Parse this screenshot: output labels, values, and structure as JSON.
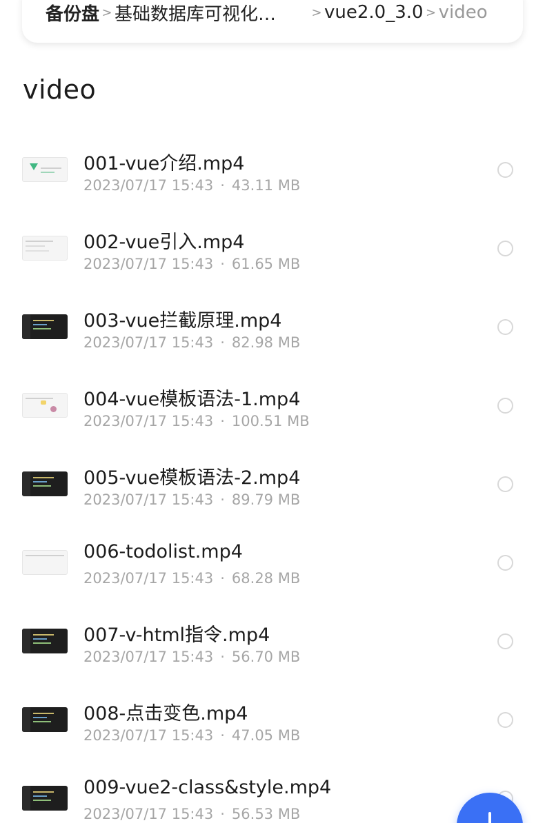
{
  "breadcrumb": {
    "root": "备份盘",
    "truncated": "基础数据库可视化…",
    "middle": "vue2.0_3.0",
    "current": "video"
  },
  "folder": {
    "title": "video"
  },
  "files": [
    {
      "name": "001-vue介绍.mp4",
      "date": "2023/07/17 15:43",
      "size": "43.11 MB",
      "thumb": "light-vue"
    },
    {
      "name": "002-vue引入.mp4",
      "date": "2023/07/17 15:43",
      "size": "61.65 MB",
      "thumb": "light"
    },
    {
      "name": "003-vue拦截原理.mp4",
      "date": "2023/07/17 15:43",
      "size": "82.98 MB",
      "thumb": "dark"
    },
    {
      "name": "004-vue模板语法-1.mp4",
      "date": "2023/07/17 15:43",
      "size": "100.51 MB",
      "thumb": "light-color"
    },
    {
      "name": "005-vue模板语法-2.mp4",
      "date": "2023/07/17 15:43",
      "size": "89.79 MB",
      "thumb": "dark"
    },
    {
      "name": "006-todolist.mp4",
      "date": "2023/07/17 15:43",
      "size": "68.28 MB",
      "thumb": "light"
    },
    {
      "name": "007-v-html指令.mp4",
      "date": "2023/07/17 15:43",
      "size": "56.70 MB",
      "thumb": "dark"
    },
    {
      "name": "008-点击变色.mp4",
      "date": "2023/07/17 15:43",
      "size": "47.05 MB",
      "thumb": "dark"
    },
    {
      "name": "009-vue2-class&style.mp4",
      "date": "2023/07/17 15:43",
      "size": "56.53 MB",
      "thumb": "dark"
    }
  ],
  "meta_separator": "·",
  "crumb_separator": ">",
  "icons": {
    "fab": "plus-icon",
    "select": "select-circle-icon",
    "thumbnail": "video-thumbnail"
  },
  "colors": {
    "fab": "#3a70f5",
    "meta_text": "#a6a6a6",
    "title_text": "#1c1c1c"
  }
}
